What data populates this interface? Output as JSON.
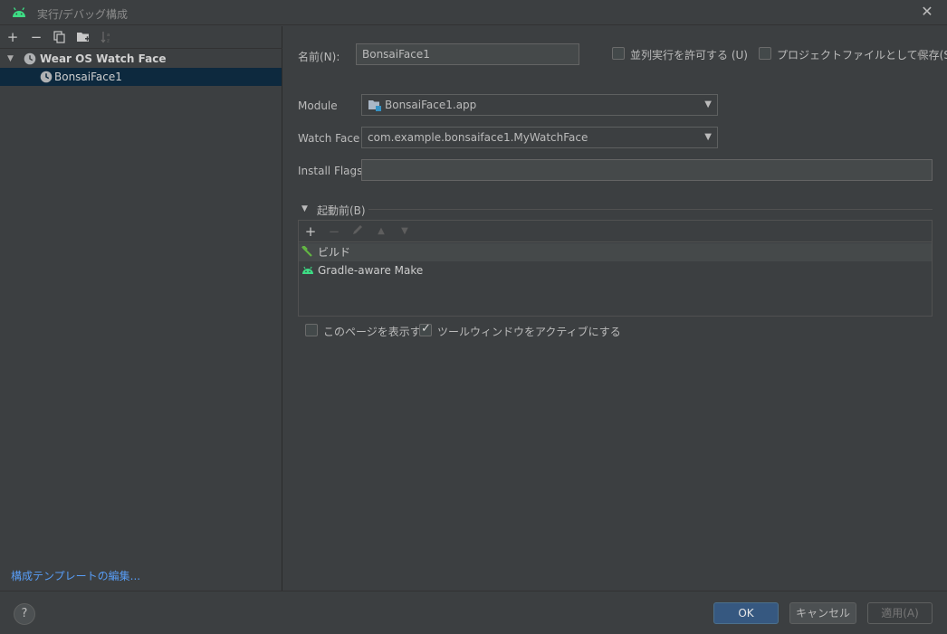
{
  "window": {
    "title": "実行/デバッグ構成",
    "close_icon": "close-icon"
  },
  "left": {
    "toolbar": {
      "add": "+",
      "remove": "−"
    },
    "tree": [
      {
        "label": "Wear OS Watch Face",
        "icon": "watch-face-icon",
        "expanded": true
      },
      {
        "label": "BonsaiFace1",
        "icon": "watch-face-icon",
        "selected": true
      }
    ],
    "edit_templates_link": "構成テンプレートの編集..."
  },
  "form": {
    "name_label": "名前(N):",
    "name_value": "BonsaiFace1",
    "allow_parallel_label": "並列実行を許可する (U)",
    "allow_parallel_checked": false,
    "store_as_project_file_label": "プロジェクトファイルとして保存(S)",
    "store_as_project_file_checked": false,
    "module_label": "Module",
    "module_value": "BonsaiFace1.app",
    "watch_face_label": "Watch Face",
    "watch_face_value": "com.example.bonsaiface1.MyWatchFace",
    "install_flags_label": "Install Flags:",
    "install_flags_value": ""
  },
  "before_launch": {
    "title": "起動前(B)",
    "toolbar": {
      "add": "+",
      "remove": "−",
      "up": "▲",
      "down": "▼"
    },
    "tasks": [
      {
        "label": "ビルド",
        "icon": "hammer-icon"
      },
      {
        "label": "Gradle-aware Make",
        "icon": "android-icon"
      }
    ],
    "show_page_label": "このページを表示する",
    "show_page_checked": false,
    "activate_tool_window_label": "ツールウィンドウをアクティブにする",
    "activate_tool_window_checked": true
  },
  "footer": {
    "help": "?",
    "ok": "OK",
    "cancel": "キャンセル",
    "apply": "適用(A)"
  },
  "colors": {
    "background": "#3c3f41",
    "selection": "#0d293e",
    "link": "#589df6",
    "primary_button": "#365880",
    "android_green": "#3ddc84"
  }
}
